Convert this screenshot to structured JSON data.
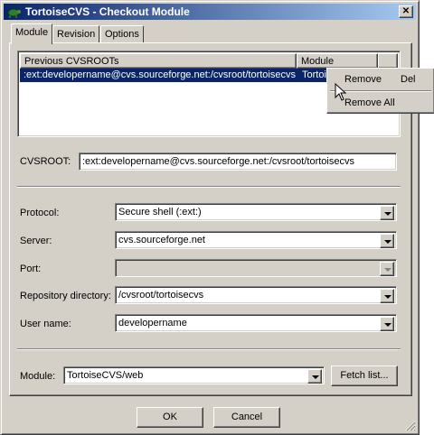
{
  "window": {
    "title": "TortoiseCVS - Checkout Module",
    "close_glyph": "✕",
    "icon": "tortoise-icon"
  },
  "tabs": [
    {
      "label": "Module",
      "active": true
    },
    {
      "label": "Revision",
      "active": false
    },
    {
      "label": "Options",
      "active": false
    }
  ],
  "cvsroots_list": {
    "columns": [
      "Previous CVSROOTs",
      "Module"
    ],
    "rows": [
      {
        "cvsroot": ":ext:developername@cvs.sourceforge.net:/cvsroot/tortoisecvs",
        "module": "TortoiseCVS",
        "selected": true
      }
    ]
  },
  "context_menu": {
    "items": [
      {
        "label": "Remove",
        "shortcut": "Del"
      },
      {
        "label": "Remove All",
        "shortcut": ""
      }
    ]
  },
  "cvsroot": {
    "label": "CVSROOT:",
    "value": ":ext:developername@cvs.sourceforge.net:/cvsroot/tortoisecvs"
  },
  "fields": {
    "protocol": {
      "label": "Protocol:",
      "value": "Secure shell (:ext:)"
    },
    "server": {
      "label": "Server:",
      "value": "cvs.sourceforge.net"
    },
    "port": {
      "label": "Port:",
      "value": ""
    },
    "repository": {
      "label": "Repository directory:",
      "value": "/cvsroot/tortoisecvs"
    },
    "username": {
      "label": "User name:",
      "value": "developername"
    }
  },
  "module": {
    "label": "Module:",
    "value": "TortoiseCVS/web",
    "fetch_button": "Fetch list..."
  },
  "buttons": {
    "ok": "OK",
    "cancel": "Cancel"
  },
  "colors": {
    "face": "#d4d0c8",
    "selection": "#0a246a",
    "title_gradient_start": "#0a246a",
    "title_gradient_end": "#a6caf0"
  }
}
